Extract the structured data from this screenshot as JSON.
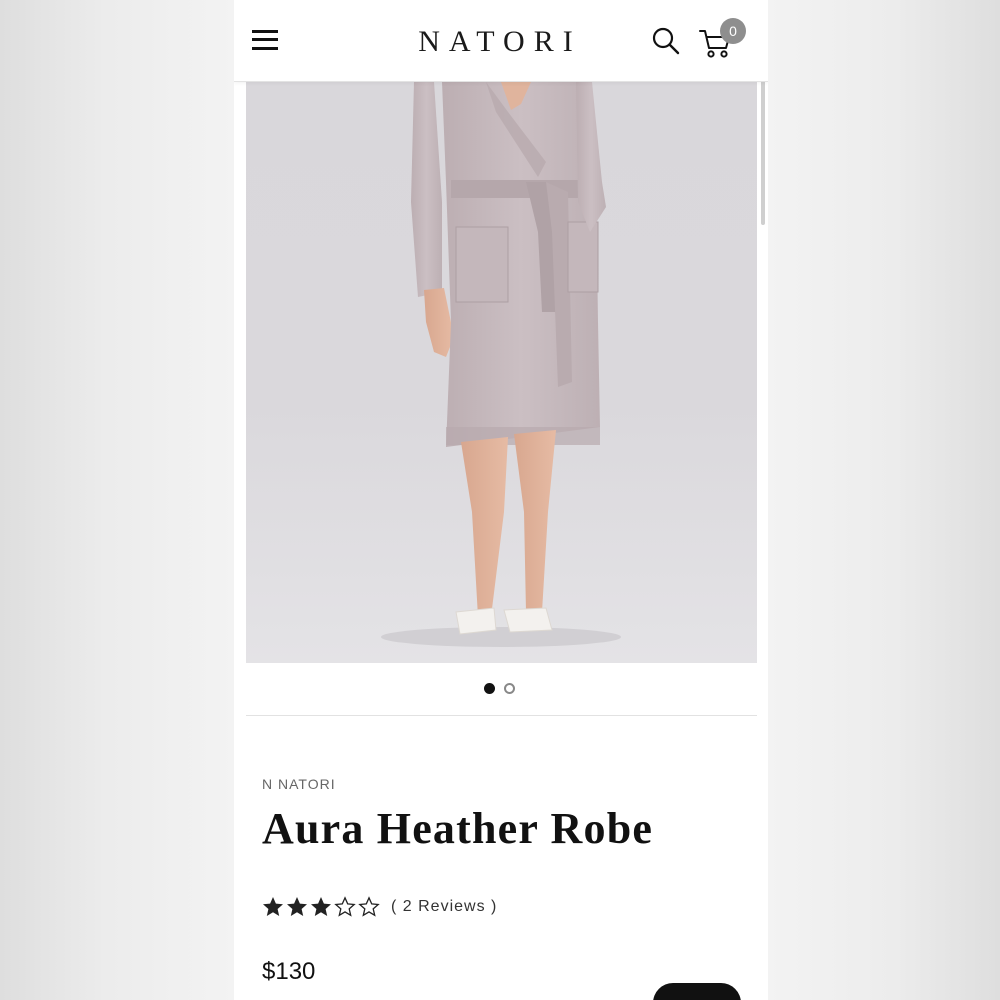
{
  "header": {
    "logo_text": "NATORI",
    "cart_count": "0"
  },
  "gallery": {
    "image_count": 2,
    "active_index": 0
  },
  "product": {
    "brand": "N NATORI",
    "title": "Aura Heather Robe",
    "rating": 3,
    "rating_max": 5,
    "reviews_label": "( 2 Reviews )",
    "price": "$130"
  },
  "colors": {
    "text": "#111111",
    "badge": "#8e8e8e",
    "robe": "#c7b9bd"
  },
  "icons": [
    "menu-icon",
    "search-icon",
    "cart-icon",
    "star-icon"
  ]
}
